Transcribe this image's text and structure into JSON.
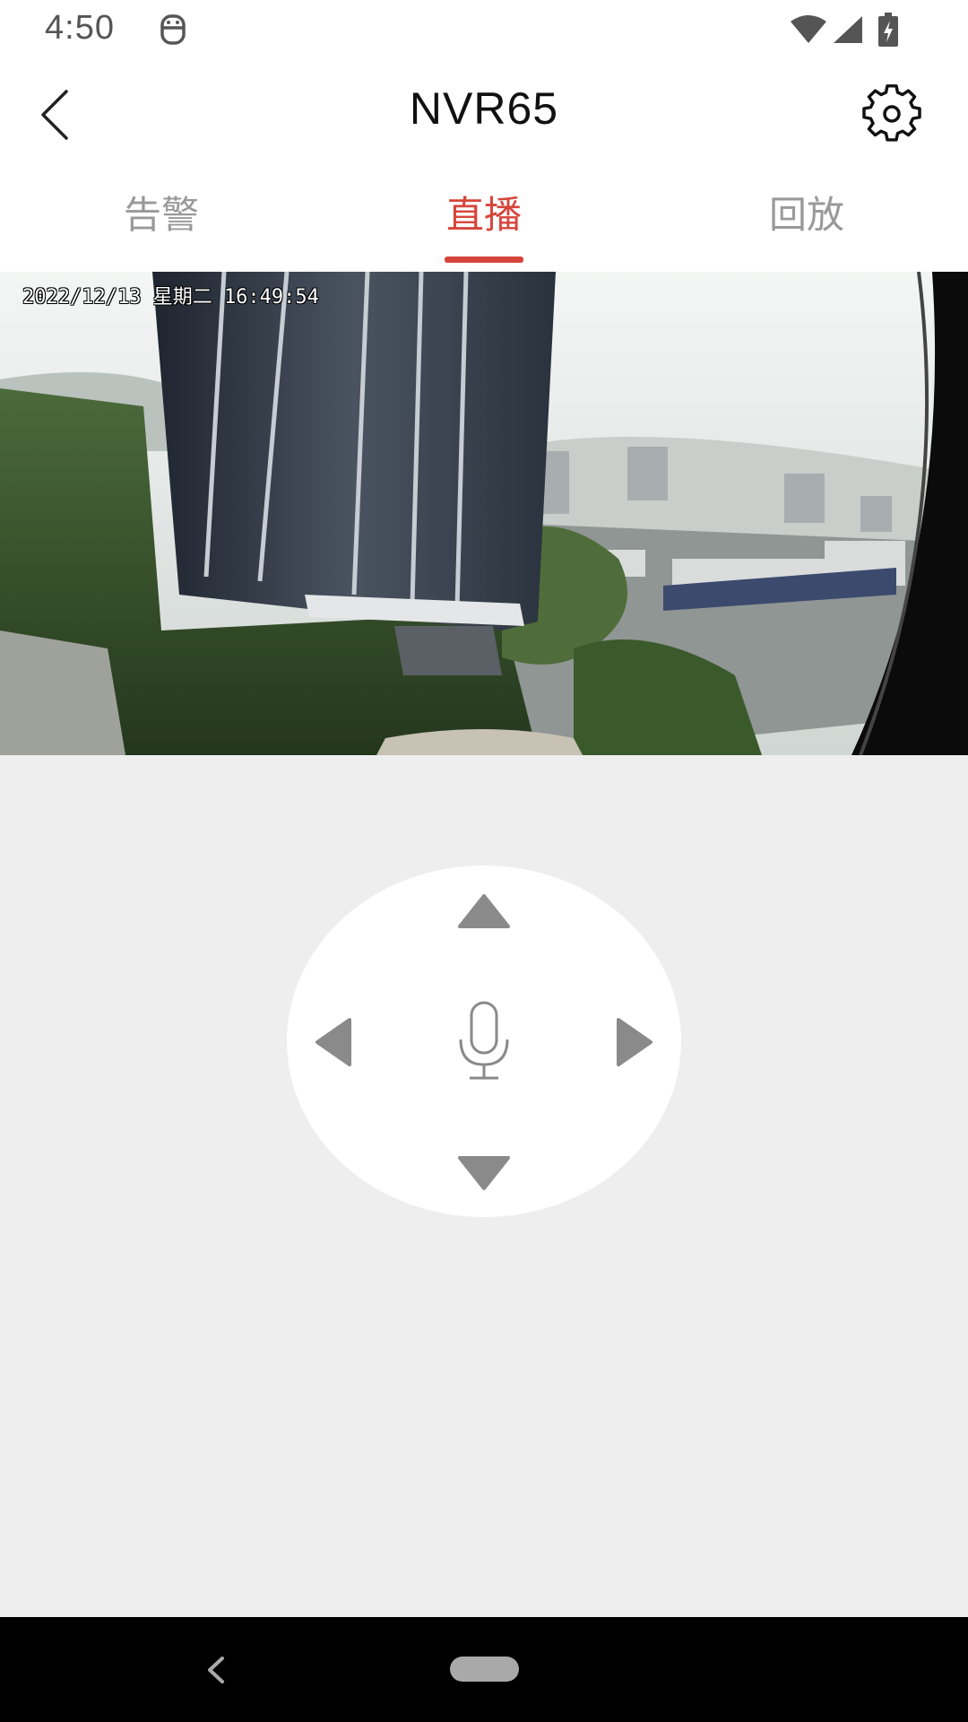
{
  "status_bar": {
    "time": "4:50",
    "icons": [
      "notification-face-icon",
      "wifi-icon",
      "signal-icon",
      "battery-charging-icon"
    ]
  },
  "app_bar": {
    "title": "NVR65",
    "back_icon": "chevron-left-icon",
    "settings_icon": "gear-icon"
  },
  "tabs": [
    {
      "label": "告警",
      "active": false
    },
    {
      "label": "直播",
      "active": true
    },
    {
      "label": "回放",
      "active": false
    }
  ],
  "video": {
    "timestamp": "2022/12/13 星期二 16:49:54"
  },
  "ptz": {
    "controls": [
      "up-arrow-icon",
      "down-arrow-icon",
      "left-arrow-icon",
      "right-arrow-icon",
      "microphone-icon"
    ]
  },
  "colors": {
    "accent": "#d6453b",
    "background": "#eeeeee",
    "inactive_tab": "#999999",
    "control_gray": "#8a8a8a"
  }
}
